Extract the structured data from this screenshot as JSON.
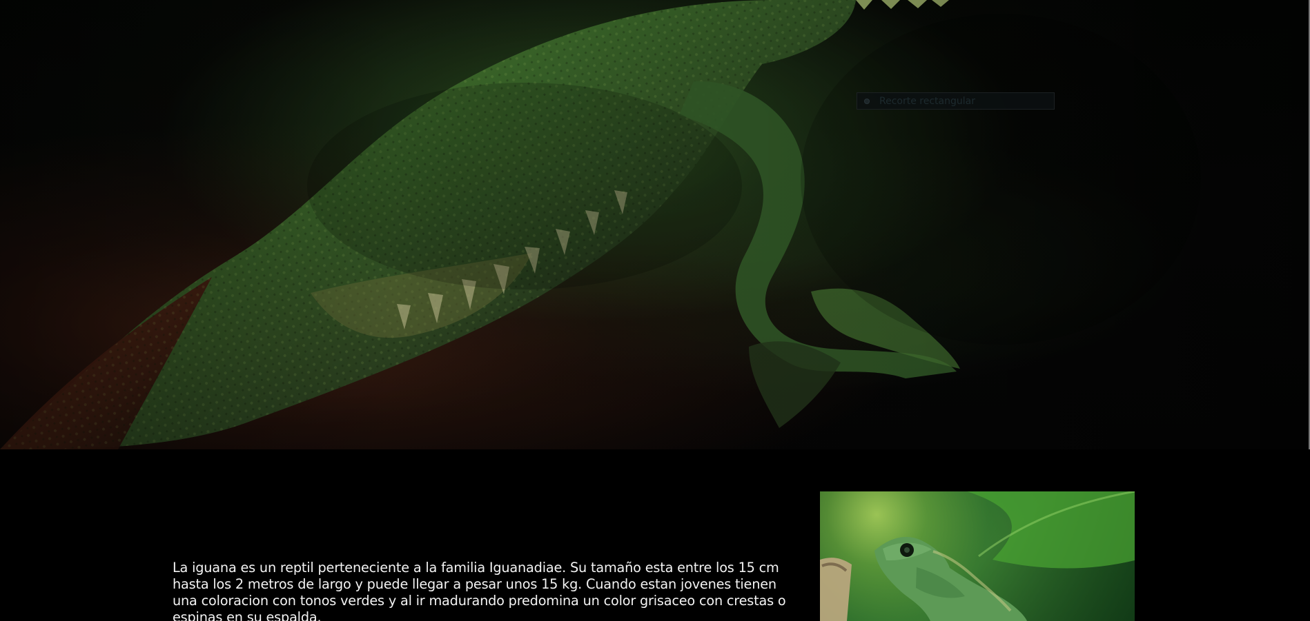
{
  "hero": {
    "image_alt": "Iguana close-up hero image"
  },
  "tooltip": {
    "label": "Recorte rectangular",
    "icon": "snip-icon"
  },
  "content": {
    "description": "La iguana es un reptil perteneciente a la familia Iguanadiae. Su tamaño esta entre los 15 cm hasta los 2 metros de largo y puede llegar a pesar unos 15 kg. Cuando estan jovenes tienen una coloracion con tonos verdes y al ir madurando predomina un color grisaceo con crestas o espinas en su espalda."
  },
  "side_image": {
    "image_alt": "Green iguana on branch"
  },
  "colors": {
    "page_background": "#000000",
    "text": "#f3f3f3",
    "tooltip_background": "#0c1012",
    "lizard_green": "#4e8b35",
    "lizard_red": "#5e2a17"
  }
}
